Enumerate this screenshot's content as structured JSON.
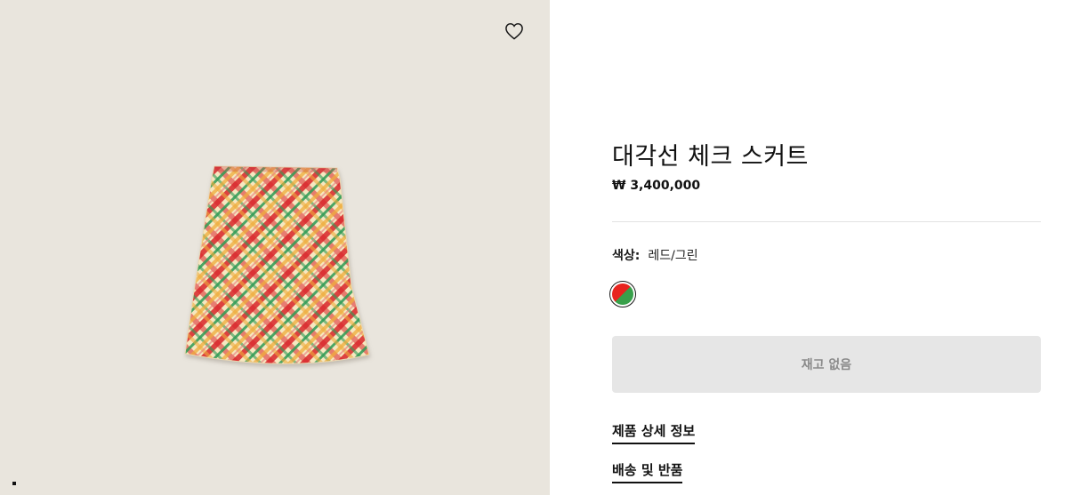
{
  "product": {
    "title": "대각선 체크 스커트",
    "price": "₩ 3,400,000",
    "color_label": "색상:",
    "color_value": "레드/그린",
    "swatch_colors": [
      "#e8231e",
      "#38a04a"
    ],
    "availability_button": "재고 없음"
  },
  "gallery": {
    "wishlist_icon": "heart-outline-icon",
    "background": "#e9e5dd"
  },
  "links": {
    "details": "제품 상세 정보",
    "shipping": "배송 및 반품"
  }
}
